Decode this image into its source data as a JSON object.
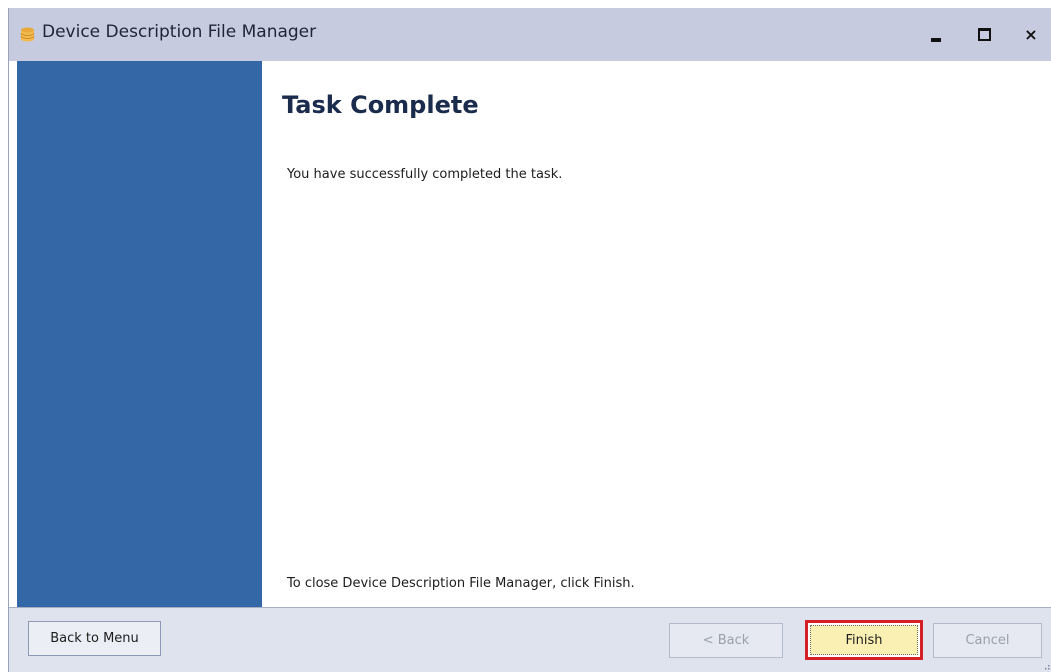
{
  "window": {
    "title": "Device Description File Manager",
    "icon": "database-icon",
    "controls": {
      "minimize_icon": "minimize-icon",
      "maximize_icon": "maximize-icon",
      "close_label": "×"
    }
  },
  "sidebar": {
    "color": "#3467a6"
  },
  "content": {
    "heading": "Task Complete",
    "message": "You have successfully completed the task.",
    "close_instruction": "To close Device Description File Manager, click Finish."
  },
  "footer": {
    "back_to_menu_label": "Back to Menu",
    "back_label": "< Back",
    "finish_label": "Finish",
    "cancel_label": "Cancel",
    "finish_highlight_color": "#d51f26"
  }
}
